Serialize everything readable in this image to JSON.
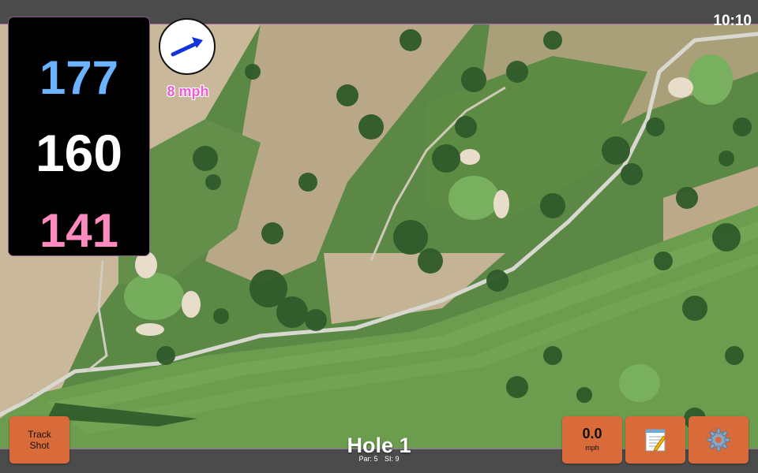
{
  "status_bar": {
    "time": "10:10"
  },
  "distances": {
    "back": "177",
    "middle": "160",
    "front": "141"
  },
  "wind": {
    "speed_label": "8 mph",
    "direction_icon": "arrow-right-up-icon"
  },
  "buttons": {
    "track_shot_line1": "Track",
    "track_shot_line2": "Shot",
    "speed_value": "0.0",
    "speed_unit": "mph",
    "notes_icon": "notepad-icon",
    "settings_icon": "gear-icon"
  },
  "hole": {
    "title": "Hole 1",
    "par": "Par: 5",
    "si": "SI: 9"
  },
  "colors": {
    "back": "#6bb2ff",
    "middle": "#ffffff",
    "front": "#ff8ac0",
    "wind": "#ee5cd0",
    "button": "#d96b3b",
    "wind_arrow": "#1133dd"
  }
}
